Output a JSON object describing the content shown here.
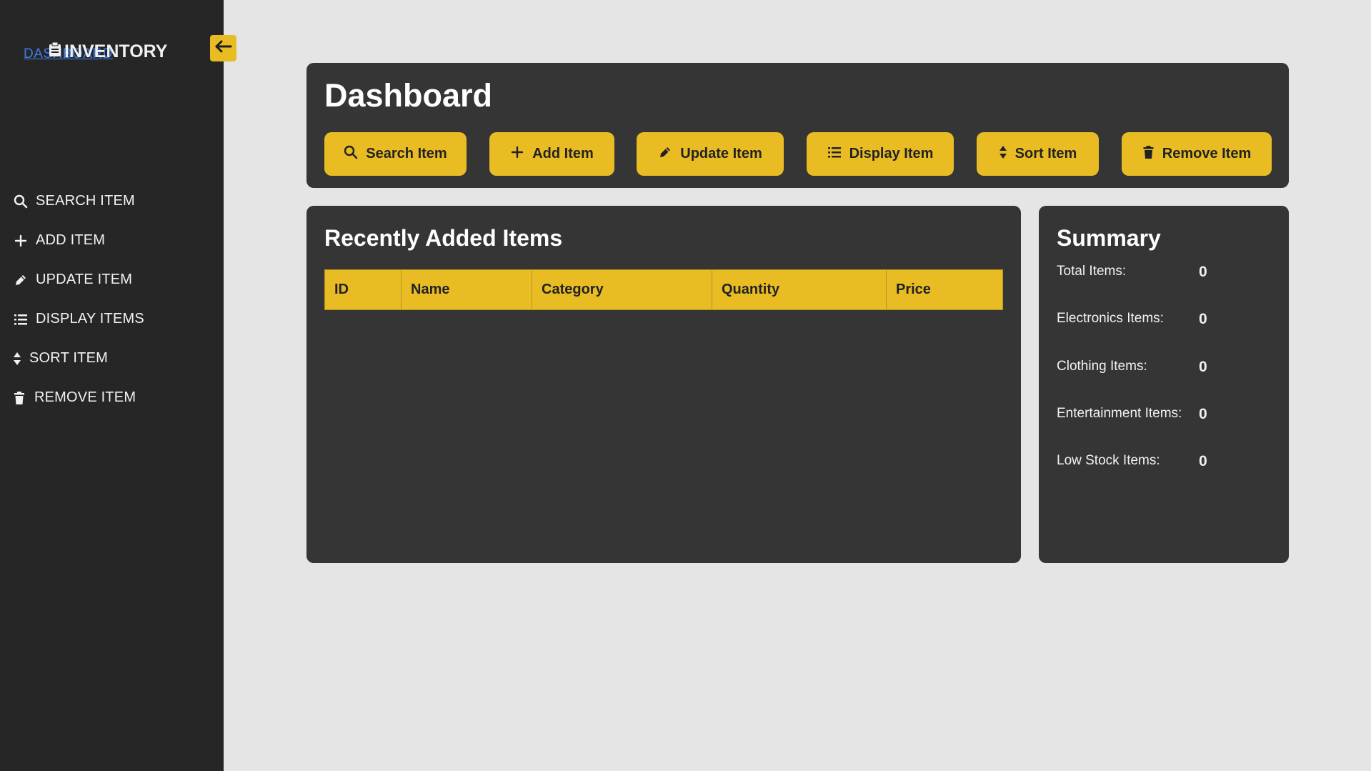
{
  "sidebar": {
    "brand_link": "DASHBOARD",
    "brand_title": "INVENTORY",
    "items": [
      {
        "label": "SEARCH ITEM",
        "icon": "search-icon"
      },
      {
        "label": "ADD ITEM",
        "icon": "plus-icon"
      },
      {
        "label": "UPDATE ITEM",
        "icon": "pencil-icon"
      },
      {
        "label": "DISPLAY ITEMS",
        "icon": "list-icon"
      },
      {
        "label": "SORT ITEM",
        "icon": "sort-icon"
      },
      {
        "label": "REMOVE ITEM",
        "icon": "trash-icon"
      }
    ]
  },
  "header": {
    "title": "Dashboard",
    "buttons": [
      {
        "label": "Search Item",
        "icon": "search-icon"
      },
      {
        "label": "Add Item",
        "icon": "plus-icon"
      },
      {
        "label": "Update Item",
        "icon": "pencil-icon"
      },
      {
        "label": "Display Item",
        "icon": "list-icon"
      },
      {
        "label": "Sort Item",
        "icon": "sort-icon"
      },
      {
        "label": "Remove Item",
        "icon": "trash-icon"
      }
    ]
  },
  "recent": {
    "title": "Recently Added Items",
    "columns": [
      "ID",
      "Name",
      "Category",
      "Quantity",
      "Price"
    ],
    "rows": []
  },
  "summary": {
    "title": "Summary",
    "rows": [
      {
        "label": "Total Items:",
        "value": "0"
      },
      {
        "label": "Electronics Items:",
        "value": "0"
      },
      {
        "label": "Clothing Items:",
        "value": "0"
      },
      {
        "label": "Entertainment Items:",
        "value": "0"
      },
      {
        "label": "Low Stock Items:",
        "value": "0"
      }
    ]
  },
  "colors": {
    "accent": "#e9bc24",
    "sidebar_bg": "#262626",
    "panel_bg": "#353535",
    "page_bg": "#e5e5e5"
  }
}
